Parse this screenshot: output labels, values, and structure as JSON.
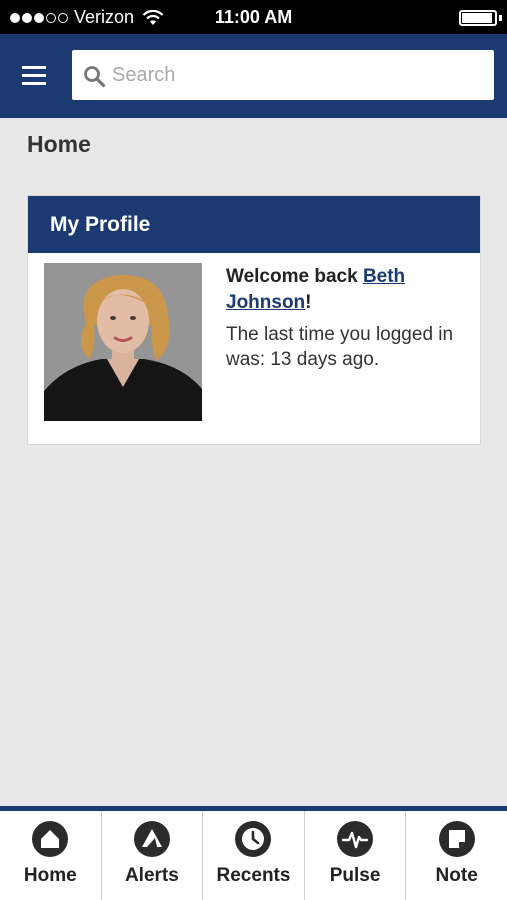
{
  "status_bar": {
    "carrier": "Verizon",
    "time": "11:00 AM",
    "signal_bars_filled": 3,
    "signal_bars_total": 5,
    "battery_level": 0.95
  },
  "header": {
    "menu_icon": "hamburger-icon",
    "search": {
      "placeholder": "Search",
      "value": ""
    }
  },
  "page": {
    "title": "Home"
  },
  "profile_card": {
    "title": "My Profile",
    "welcome_prefix": "Welcome back ",
    "user_name": "Beth Johnson",
    "welcome_suffix": "!",
    "last_login_text": "The last time you logged in was: 13 days ago."
  },
  "tabs": [
    {
      "label": "Home",
      "icon": "home-icon"
    },
    {
      "label": "Alerts",
      "icon": "alert-icon"
    },
    {
      "label": "Recents",
      "icon": "clock-icon"
    },
    {
      "label": "Pulse",
      "icon": "pulse-icon"
    },
    {
      "label": "Note",
      "icon": "note-icon"
    }
  ],
  "colors": {
    "brand": "#1c3a72",
    "background": "#e8e8e8",
    "card": "#ffffff"
  }
}
